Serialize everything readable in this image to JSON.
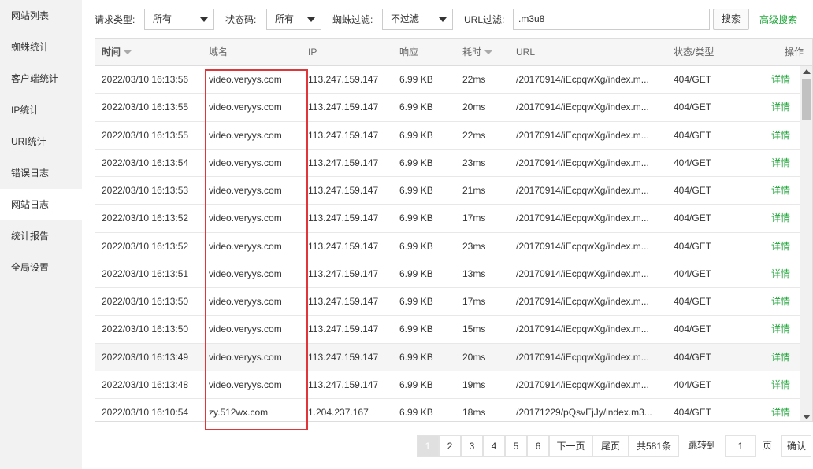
{
  "sidebar": {
    "items": [
      {
        "label": "网站列表"
      },
      {
        "label": "蜘蛛统计"
      },
      {
        "label": "客户端统计"
      },
      {
        "label": "IP统计"
      },
      {
        "label": "URI统计"
      },
      {
        "label": "错误日志"
      },
      {
        "label": "网站日志"
      },
      {
        "label": "统计报告"
      },
      {
        "label": "全局设置"
      }
    ],
    "active_index": 6
  },
  "filters": {
    "request_type_label": "请求类型:",
    "request_type_value": "所有",
    "status_code_label": "状态码:",
    "status_code_value": "所有",
    "spider_label": "蜘蛛过滤:",
    "spider_value": "不过滤",
    "url_label": "URL过滤:",
    "url_value": ".m3u8",
    "search_label": "搜索",
    "advanced_label": "高级搜索"
  },
  "table": {
    "headers": {
      "time": "时间",
      "domain": "域名",
      "ip": "IP",
      "response": "响应",
      "elapsed": "耗时",
      "url": "URL",
      "status": "状态/类型",
      "action": "操作"
    },
    "rows": [
      {
        "time": "2022/03/10 16:13:56",
        "domain": "video.veryys.com",
        "ip": "113.247.159.147",
        "response": "6.99 KB",
        "elapsed": "22ms",
        "url": "/20170914/iEcpqwXg/index.m...",
        "status": "404/GET",
        "action": "详情"
      },
      {
        "time": "2022/03/10 16:13:55",
        "domain": "video.veryys.com",
        "ip": "113.247.159.147",
        "response": "6.99 KB",
        "elapsed": "20ms",
        "url": "/20170914/iEcpqwXg/index.m...",
        "status": "404/GET",
        "action": "详情"
      },
      {
        "time": "2022/03/10 16:13:55",
        "domain": "video.veryys.com",
        "ip": "113.247.159.147",
        "response": "6.99 KB",
        "elapsed": "22ms",
        "url": "/20170914/iEcpqwXg/index.m...",
        "status": "404/GET",
        "action": "详情"
      },
      {
        "time": "2022/03/10 16:13:54",
        "domain": "video.veryys.com",
        "ip": "113.247.159.147",
        "response": "6.99 KB",
        "elapsed": "23ms",
        "url": "/20170914/iEcpqwXg/index.m...",
        "status": "404/GET",
        "action": "详情"
      },
      {
        "time": "2022/03/10 16:13:53",
        "domain": "video.veryys.com",
        "ip": "113.247.159.147",
        "response": "6.99 KB",
        "elapsed": "21ms",
        "url": "/20170914/iEcpqwXg/index.m...",
        "status": "404/GET",
        "action": "详情"
      },
      {
        "time": "2022/03/10 16:13:52",
        "domain": "video.veryys.com",
        "ip": "113.247.159.147",
        "response": "6.99 KB",
        "elapsed": "17ms",
        "url": "/20170914/iEcpqwXg/index.m...",
        "status": "404/GET",
        "action": "详情"
      },
      {
        "time": "2022/03/10 16:13:52",
        "domain": "video.veryys.com",
        "ip": "113.247.159.147",
        "response": "6.99 KB",
        "elapsed": "23ms",
        "url": "/20170914/iEcpqwXg/index.m...",
        "status": "404/GET",
        "action": "详情"
      },
      {
        "time": "2022/03/10 16:13:51",
        "domain": "video.veryys.com",
        "ip": "113.247.159.147",
        "response": "6.99 KB",
        "elapsed": "13ms",
        "url": "/20170914/iEcpqwXg/index.m...",
        "status": "404/GET",
        "action": "详情"
      },
      {
        "time": "2022/03/10 16:13:50",
        "domain": "video.veryys.com",
        "ip": "113.247.159.147",
        "response": "6.99 KB",
        "elapsed": "17ms",
        "url": "/20170914/iEcpqwXg/index.m...",
        "status": "404/GET",
        "action": "详情"
      },
      {
        "time": "2022/03/10 16:13:50",
        "domain": "video.veryys.com",
        "ip": "113.247.159.147",
        "response": "6.99 KB",
        "elapsed": "15ms",
        "url": "/20170914/iEcpqwXg/index.m...",
        "status": "404/GET",
        "action": "详情"
      },
      {
        "time": "2022/03/10 16:13:49",
        "domain": "video.veryys.com",
        "ip": "113.247.159.147",
        "response": "6.99 KB",
        "elapsed": "20ms",
        "url": "/20170914/iEcpqwXg/index.m...",
        "status": "404/GET",
        "action": "详情"
      },
      {
        "time": "2022/03/10 16:13:48",
        "domain": "video.veryys.com",
        "ip": "113.247.159.147",
        "response": "6.99 KB",
        "elapsed": "19ms",
        "url": "/20170914/iEcpqwXg/index.m...",
        "status": "404/GET",
        "action": "详情"
      },
      {
        "time": "2022/03/10 16:10:54",
        "domain": "zy.512wx.com",
        "ip": "1.204.237.167",
        "response": "6.99 KB",
        "elapsed": "18ms",
        "url": "/20171229/pQsvEjJy/index.m3...",
        "status": "404/GET",
        "action": "详情"
      }
    ],
    "hover_row_index": 10
  },
  "pagination": {
    "pages": [
      "1",
      "2",
      "3",
      "4",
      "5",
      "6"
    ],
    "current": "1",
    "next_label": "下一页",
    "last_label": "尾页",
    "total_label": "共581条",
    "goto_label": "跳转到",
    "goto_value": "1",
    "page_unit": "页",
    "confirm_label": "确认"
  },
  "colors": {
    "accent_green": "#20a53a",
    "highlight_red": "#e0363a",
    "sidebar_bg": "#f2f2f2"
  }
}
